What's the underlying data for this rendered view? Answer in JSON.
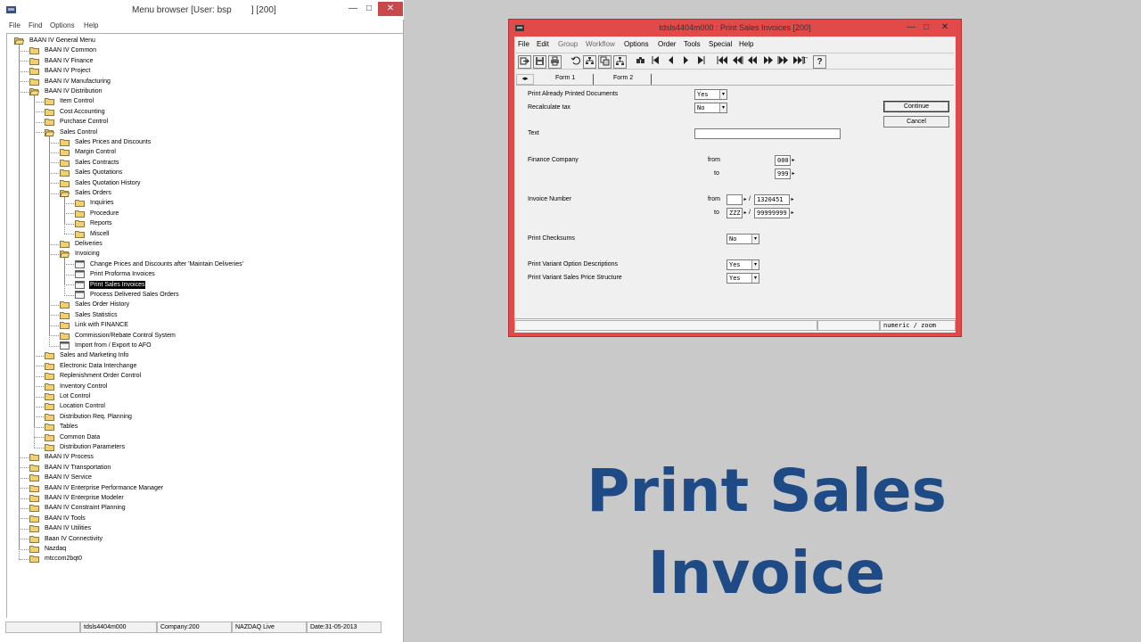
{
  "menu_browser": {
    "title": "Menu browser [User: bsp        ] [200]",
    "window_buttons": {
      "minimize": "—",
      "maximize": "□",
      "close": "✕"
    },
    "menu": [
      "File",
      "Find",
      "Options",
      "Help"
    ],
    "tree": [
      {
        "label": "BAAN IV General Menu",
        "level": 0,
        "icon": "folder-open",
        "children": [
          {
            "label": "BAAN IV Common",
            "level": 1,
            "icon": "folder"
          },
          {
            "label": "BAAN IV Finance",
            "level": 1,
            "icon": "folder"
          },
          {
            "label": "BAAN IV Project",
            "level": 1,
            "icon": "folder"
          },
          {
            "label": "BAAN IV Manufacturing",
            "level": 1,
            "icon": "folder"
          },
          {
            "label": "BAAN IV Distribution",
            "level": 1,
            "icon": "folder-open"
          },
          {
            "label": "Item Control",
            "level": 2,
            "icon": "folder"
          },
          {
            "label": "Cost Accounting",
            "level": 2,
            "icon": "folder"
          },
          {
            "label": "Purchase Control",
            "level": 2,
            "icon": "folder"
          },
          {
            "label": "Sales Control",
            "level": 2,
            "icon": "folder-open"
          },
          {
            "label": "Sales Prices and Discounts",
            "level": 3,
            "icon": "folder"
          },
          {
            "label": "Margin Control",
            "level": 3,
            "icon": "folder"
          },
          {
            "label": "Sales Contracts",
            "level": 3,
            "icon": "folder"
          },
          {
            "label": "Sales Quotations",
            "level": 3,
            "icon": "folder"
          },
          {
            "label": "Sales Quotation History",
            "level": 3,
            "icon": "folder"
          },
          {
            "label": "Sales Orders",
            "level": 3,
            "icon": "folder-open"
          },
          {
            "label": "Inquiries",
            "level": 4,
            "icon": "folder"
          },
          {
            "label": "Procedure",
            "level": 4,
            "icon": "folder"
          },
          {
            "label": "Reports",
            "level": 4,
            "icon": "folder"
          },
          {
            "label": "Miscell",
            "level": 4,
            "icon": "folder"
          },
          {
            "label": "Deliveries",
            "level": 3,
            "icon": "folder"
          },
          {
            "label": "Invoicing",
            "level": 3,
            "icon": "folder-open"
          },
          {
            "label": "Change Prices and Discounts after 'Maintain Deliveries'",
            "level": 4,
            "icon": "session"
          },
          {
            "label": "Print Proforma Invoices",
            "level": 4,
            "icon": "session"
          },
          {
            "label": "Print Sales Invoices",
            "level": 4,
            "icon": "session",
            "selected": true
          },
          {
            "label": "Process Delivered Sales Orders",
            "level": 4,
            "icon": "session"
          },
          {
            "label": "Sales Order History",
            "level": 3,
            "icon": "folder"
          },
          {
            "label": "Sales Statistics",
            "level": 3,
            "icon": "folder"
          },
          {
            "label": "Link with FINANCE",
            "level": 3,
            "icon": "folder"
          },
          {
            "label": "Commission/Rebate Control System",
            "level": 3,
            "icon": "folder"
          },
          {
            "label": "Import from / Export to AFO",
            "level": 3,
            "icon": "session"
          },
          {
            "label": "Sales and Marketing Info",
            "level": 2,
            "icon": "folder"
          },
          {
            "label": "Electronic Data Interchange",
            "level": 2,
            "icon": "folder"
          },
          {
            "label": "Replenishment Order Control",
            "level": 2,
            "icon": "folder"
          },
          {
            "label": "Inventory Control",
            "level": 2,
            "icon": "folder"
          },
          {
            "label": "Lot Control",
            "level": 2,
            "icon": "folder"
          },
          {
            "label": "Location Control",
            "level": 2,
            "icon": "folder"
          },
          {
            "label": "Distribution Req. Planning",
            "level": 2,
            "icon": "folder"
          },
          {
            "label": "Tables",
            "level": 2,
            "icon": "folder"
          },
          {
            "label": "Common Data",
            "level": 2,
            "icon": "folder"
          },
          {
            "label": "Distribution Parameters",
            "level": 2,
            "icon": "folder"
          },
          {
            "label": "BAAN IV Process",
            "level": 1,
            "icon": "folder"
          },
          {
            "label": "BAAN IV Transportation",
            "level": 1,
            "icon": "folder"
          },
          {
            "label": "BAAN IV Service",
            "level": 1,
            "icon": "folder"
          },
          {
            "label": "BAAN IV Enterprise Performance Manager",
            "level": 1,
            "icon": "folder"
          },
          {
            "label": "BAAN IV Enterprise Modeler",
            "level": 1,
            "icon": "folder"
          },
          {
            "label": "BAAN IV Constraint Planning",
            "level": 1,
            "icon": "folder"
          },
          {
            "label": "BAAN IV Tools",
            "level": 1,
            "icon": "folder"
          },
          {
            "label": "BAAN IV Utilities",
            "level": 1,
            "icon": "folder"
          },
          {
            "label": "Baan IV Connectivity",
            "level": 1,
            "icon": "folder"
          },
          {
            "label": "Nazdaq",
            "level": 1,
            "icon": "folder"
          },
          {
            "label": "mtccom2bqt0",
            "level": 1,
            "icon": "folder"
          }
        ]
      }
    ],
    "status": {
      "session": "tdsls4404m000",
      "company": "Company:200",
      "environment": "NAZDAQ Live",
      "date": "Date:31-05-2013"
    }
  },
  "session_window": {
    "title": "tdsls4404m000 : Print Sales Invoices [200]",
    "window_buttons": {
      "minimize": "—",
      "maximize": "□",
      "close": "✕"
    },
    "menu": [
      {
        "label": "File",
        "enabled": true
      },
      {
        "label": "Edit",
        "enabled": true
      },
      {
        "label": "Group",
        "enabled": false
      },
      {
        "label": "Workflow",
        "enabled": false
      },
      {
        "label": "Options",
        "enabled": true
      },
      {
        "label": "Order",
        "enabled": true
      },
      {
        "label": "Tools",
        "enabled": true
      },
      {
        "label": "Special",
        "enabled": true
      },
      {
        "label": "Help",
        "enabled": true
      }
    ],
    "toolbar_icons": [
      "exit-icon",
      "save-icon",
      "print-icon",
      "undo-icon",
      "tree-icon",
      "copy-icon",
      "tree-branch-icon",
      "find-icon",
      "first-record-icon",
      "previous-record-icon",
      "next-record-icon",
      "last-record-icon",
      "first-page-icon",
      "previous-page-icon",
      "previous-group-icon",
      "next-group-icon",
      "next-page-icon",
      "last-page-icon",
      "text-icon",
      "context-help-icon"
    ],
    "toolbar_glyphs": {
      "text": "T",
      "help": "?"
    },
    "tabs": {
      "nav": "◂▸",
      "tab1": "Form 1",
      "tab2": "Form 2"
    },
    "fields": {
      "print_already_printed": {
        "label": "Print Already Printed Documents",
        "value": "Yes"
      },
      "recalculate_tax": {
        "label": "Recalculate tax",
        "value": "No"
      },
      "text": {
        "label": "Text",
        "value": ""
      },
      "finance_company": {
        "label": "Finance Company",
        "from_label": "from",
        "to_label": "to",
        "from": "000",
        "to": "999"
      },
      "invoice_number": {
        "label": "Invoice Number",
        "from_label": "from",
        "to_label": "to",
        "from_series": "",
        "from_number": "1320451",
        "to_series": "ZZZ",
        "to_number": "99999999",
        "separator": "/"
      },
      "print_checksums": {
        "label": "Print Checksums",
        "value": "No"
      },
      "print_variant_option": {
        "label": "Print Variant Option Descriptions",
        "value": "Yes"
      },
      "print_variant_price": {
        "label": "Print Variant Sales Price Structure",
        "value": "Yes"
      }
    },
    "buttons": {
      "continue": "Continue",
      "cancel": "Cancel"
    },
    "status": {
      "left": "",
      "middle": "",
      "right": "numeric / zoom"
    }
  },
  "caption": {
    "line1": "Print Sales",
    "line2": "Invoice"
  },
  "colors": {
    "session_border": "#e24a4a",
    "caption": "#1e4b85",
    "desktop": "#c9c9c9",
    "folder": "#f2d070"
  }
}
